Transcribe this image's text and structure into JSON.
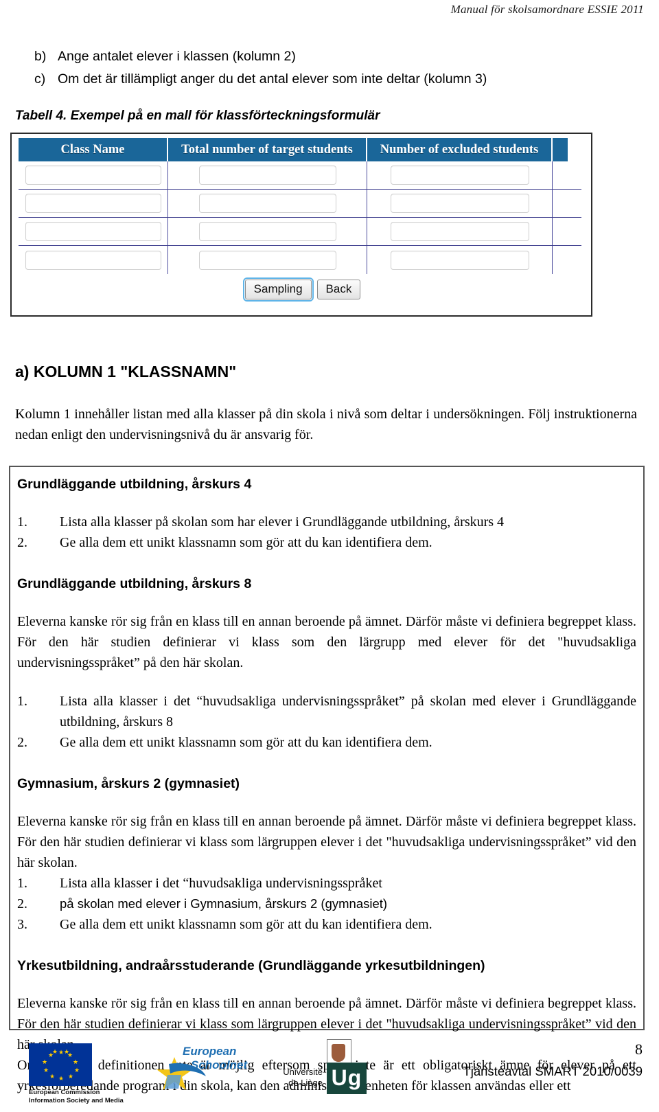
{
  "header": {
    "running_title": "Manual för skolsamordnare ESSIE 2011"
  },
  "top_list": [
    {
      "marker": "b)",
      "text": "Ange antalet elever i klassen (kolumn 2)"
    },
    {
      "marker": "c)",
      "text": "Om det är tillämpligt anger du det antal elever som inte deltar (kolumn 3)"
    }
  ],
  "table_caption": "Tabell 4. Exempel på en mall för klassförteckningsformulär",
  "form_screenshot": {
    "columns": [
      "Class Name",
      "Total number of target students",
      "Number of excluded students",
      ""
    ],
    "header_bg": "#1a6699",
    "header_color": "#ffffff",
    "row_count": 4,
    "rows": [
      {
        "class_name": "",
        "total_target": "",
        "excluded": ""
      },
      {
        "class_name": "",
        "total_target": "",
        "excluded": ""
      },
      {
        "class_name": "",
        "total_target": "",
        "excluded": ""
      },
      {
        "class_name": "",
        "total_target": "",
        "excluded": ""
      }
    ],
    "buttons": {
      "sampling": "Sampling",
      "back": "Back"
    }
  },
  "section": {
    "heading_marker": "a)",
    "heading_word": "Kolumn 1",
    "heading_rest": "\"Klassnamn\"",
    "heading_full": "a) KOLUMN 1 \"KLASSNAMN\"",
    "intro": "Kolumn 1 innehåller listan med alla klasser på din skola i nivå som deltar i undersökningen. Följ instruktionerna nedan enligt den undervisningsnivå du är ansvarig för."
  },
  "levels": [
    {
      "heading": "Grundläggande utbildning, årskurs 4",
      "paragraphs": [],
      "items": [
        {
          "marker": "1.",
          "text": "Lista alla klasser på skolan som har elever i Grundläggande utbildning, årskurs 4"
        },
        {
          "marker": "2.",
          "text": "Ge alla dem ett unikt klassnamn som gör att du kan identifiera dem."
        }
      ]
    },
    {
      "heading": "Grundläggande utbildning, årskurs 8",
      "paragraphs": [
        "Eleverna kanske rör sig från en klass till en annan beroende på ämnet. Därför måste vi definiera begreppet klass. För den här studien definierar vi klass som den lärgrupp med elever för det \"huvudsakliga undervisningsspråket” på den här skolan."
      ],
      "items": [
        {
          "marker": "1.",
          "text": "Lista alla klasser i det “huvudsakliga undervisningsspråket” på skolan med elever i Grundläggande utbildning, årskurs 8"
        },
        {
          "marker": "2.",
          "text": "Ge alla dem ett unikt klassnamn som gör att du kan identifiera dem."
        }
      ]
    },
    {
      "heading": "Gymnasium, årskurs 2 (gymnasiet)",
      "paragraphs": [
        "Eleverna kanske rör sig från en klass till en annan beroende på ämnet. Därför måste vi definiera begreppet klass. För den här studien definierar vi klass som lärgruppen elever i det \"huvudsakliga undervisningsspråket” vid den här skolan."
      ],
      "items": [
        {
          "marker": "1.",
          "text": "Lista alla klasser i det “huvudsakliga undervisningsspråket"
        },
        {
          "marker": "2.",
          "text": "på skolan med elever i Gymnasium, årskurs 2 (gymnasiet)"
        },
        {
          "marker": "3.",
          "text": "Ge alla dem ett unikt klassnamn som gör att du kan identifiera dem."
        }
      ]
    },
    {
      "heading": "Yrkesutbildning, andraårsstuderande  (Grundläggande yrkesutbildningen)",
      "paragraphs": [
        "Eleverna kanske rör sig från en klass till en annan beroende på ämnet. Därför måste vi definiera begreppet klass. För den här studien definierar vi klass som lärgruppen elever i det \"huvudsakliga undervisningsspråket” vid den här skolan.",
        "Om den här definitionen inte är möjlig eftersom språk inte är ett obligatoriskt ämne för elever på ett yrkesförberedande program i din skola, kan den administrativa enheten för klassen användas eller ett"
      ],
      "items": []
    }
  ],
  "footer": {
    "ec_logo_caption_line1": "European Commission",
    "ec_logo_caption_line2": "Information Society and Media",
    "schoolnet_word1": "European",
    "schoolnet_word2": "Schoolnet",
    "uliege_line1": "Université",
    "uliege_line2": "de Liège",
    "uliege_mark": "Ug",
    "page_number": "8",
    "contract": "Tjänsteavtal SMART 2010/0039"
  },
  "colors": {
    "table_header": "#1a6699",
    "box_border": "#555555",
    "eu_blue": "#013397",
    "eu_star": "#ffcc00",
    "schoolnet_blue": "#1f6fb2",
    "uliege_green": "#17463c"
  }
}
